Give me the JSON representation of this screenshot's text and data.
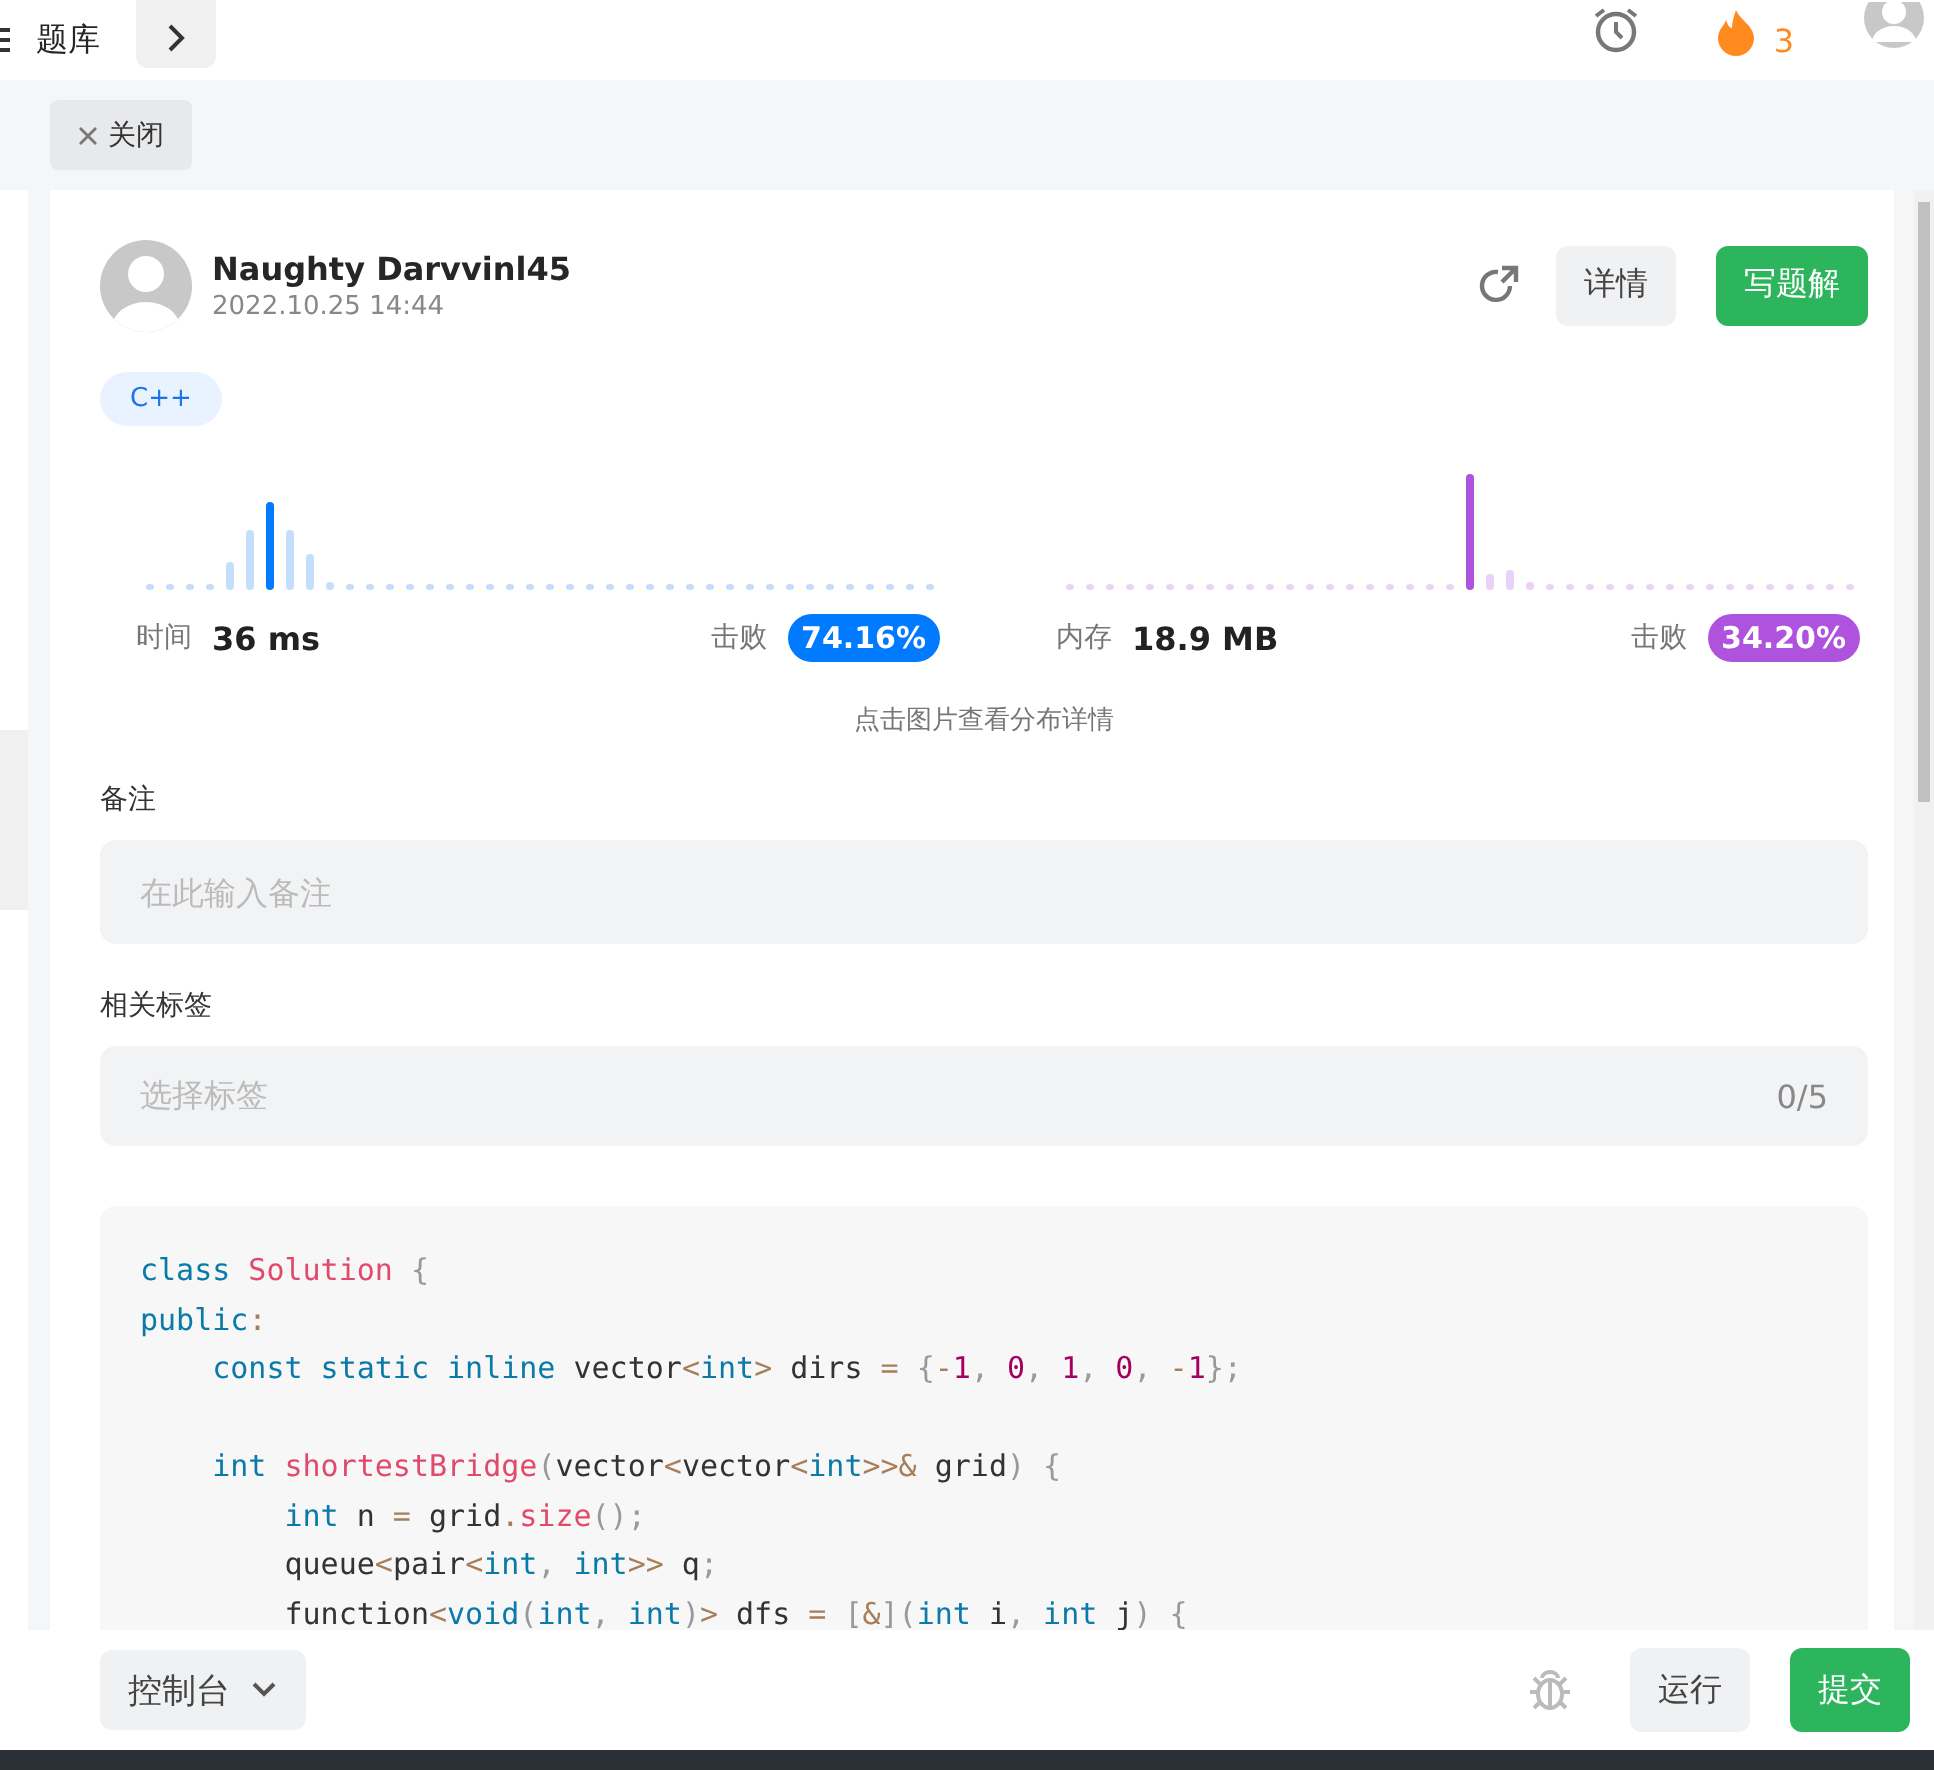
{
  "header": {
    "title": "题库",
    "streak": "3"
  },
  "close_button": "关闭",
  "solution": {
    "author": "Naughty Darvvinl45",
    "date": "2022.10.25 14:44",
    "detail_button": "详情",
    "write_button": "写题解",
    "language": "C++"
  },
  "stats": [
    {
      "label": "时间",
      "value": "36 ms",
      "beat_label": "击败",
      "beat": "74.16%",
      "color": "#007aff"
    },
    {
      "label": "内存",
      "value": "18.9 MB",
      "beat_label": "击败",
      "beat": "34.20%",
      "color": "#af52de"
    }
  ],
  "chart_hint": "点击图片查看分布详情",
  "note": {
    "label": "备注",
    "placeholder": "在此输入备注"
  },
  "tags": {
    "label": "相关标签",
    "placeholder": "选择标签",
    "count": "0/5"
  },
  "code": [
    {
      "kind": "code",
      "tokens": [
        {
          "kind": "keyword",
          "text": "class"
        },
        {
          "kind": "name",
          "text": " Solution"
        },
        {
          "kind": "punct",
          "text": " {"
        }
      ]
    },
    {
      "kind": "code",
      "tokens": [
        {
          "kind": "keyword",
          "text": "public"
        },
        {
          "kind": "op",
          "text": ":"
        }
      ]
    },
    {
      "kind": "code",
      "tokens": [
        {
          "kind": "keyword",
          "text": "    const static inline"
        },
        {
          "kind": "plain",
          "text": " vector"
        },
        {
          "kind": "op",
          "text": "<"
        },
        {
          "kind": "keyword",
          "text": "int"
        },
        {
          "kind": "op",
          "text": ">"
        },
        {
          "kind": "plain",
          "text": " dirs"
        },
        {
          "kind": "op",
          "text": " ="
        },
        {
          "kind": "punct",
          "text": " {"
        },
        {
          "kind": "op",
          "text": "-"
        },
        {
          "kind": "number",
          "text": "1"
        },
        {
          "kind": "punct",
          "text": ","
        },
        {
          "kind": "number",
          "text": " 0"
        },
        {
          "kind": "punct",
          "text": ","
        },
        {
          "kind": "number",
          "text": " 1"
        },
        {
          "kind": "punct",
          "text": ","
        },
        {
          "kind": "number",
          "text": " 0"
        },
        {
          "kind": "punct",
          "text": ","
        },
        {
          "kind": "op",
          "text": " -"
        },
        {
          "kind": "number",
          "text": "1"
        },
        {
          "kind": "punct",
          "text": "};"
        }
      ]
    },
    {
      "kind": "blank"
    },
    {
      "kind": "code",
      "tokens": [
        {
          "kind": "keyword",
          "text": "    int"
        },
        {
          "kind": "name",
          "text": " shortestBridge"
        },
        {
          "kind": "punct",
          "text": "("
        },
        {
          "kind": "plain",
          "text": "vector"
        },
        {
          "kind": "op",
          "text": "<"
        },
        {
          "kind": "plain",
          "text": "vector"
        },
        {
          "kind": "op",
          "text": "<"
        },
        {
          "kind": "keyword",
          "text": "int"
        },
        {
          "kind": "op",
          "text": ">>&"
        },
        {
          "kind": "plain",
          "text": " grid"
        },
        {
          "kind": "punct",
          "text": ") {"
        }
      ]
    },
    {
      "kind": "code",
      "tokens": [
        {
          "kind": "keyword",
          "text": "        int"
        },
        {
          "kind": "plain",
          "text": " n"
        },
        {
          "kind": "op",
          "text": " ="
        },
        {
          "kind": "plain",
          "text": " grid"
        },
        {
          "kind": "op",
          "text": "."
        },
        {
          "kind": "name",
          "text": "size"
        },
        {
          "kind": "punct",
          "text": "();"
        }
      ]
    },
    {
      "kind": "code",
      "tokens": [
        {
          "kind": "plain",
          "text": "        queue"
        },
        {
          "kind": "op",
          "text": "<"
        },
        {
          "kind": "plain",
          "text": "pair"
        },
        {
          "kind": "op",
          "text": "<"
        },
        {
          "kind": "keyword",
          "text": "int"
        },
        {
          "kind": "punct",
          "text": ","
        },
        {
          "kind": "keyword",
          "text": " int"
        },
        {
          "kind": "op",
          "text": ">>"
        },
        {
          "kind": "plain",
          "text": " q"
        },
        {
          "kind": "punct",
          "text": ";"
        }
      ]
    },
    {
      "kind": "code",
      "tokens": [
        {
          "kind": "plain",
          "text": "        function"
        },
        {
          "kind": "op",
          "text": "<"
        },
        {
          "kind": "keyword",
          "text": "void"
        },
        {
          "kind": "punct",
          "text": "("
        },
        {
          "kind": "keyword",
          "text": "int"
        },
        {
          "kind": "punct",
          "text": ","
        },
        {
          "kind": "keyword",
          "text": " int"
        },
        {
          "kind": "punct",
          "text": ")"
        },
        {
          "kind": "op",
          "text": ">"
        },
        {
          "kind": "plain",
          "text": " dfs"
        },
        {
          "kind": "op",
          "text": " ="
        },
        {
          "kind": "punct",
          "text": " ["
        },
        {
          "kind": "op",
          "text": "&"
        },
        {
          "kind": "punct",
          "text": "]("
        },
        {
          "kind": "keyword",
          "text": "int"
        },
        {
          "kind": "plain",
          "text": " i"
        },
        {
          "kind": "punct",
          "text": ","
        },
        {
          "kind": "keyword",
          "text": " int"
        },
        {
          "kind": "plain",
          "text": " j"
        },
        {
          "kind": "punct",
          "text": ") {"
        }
      ]
    }
  ],
  "bottom": {
    "console": "控制台",
    "run": "运行",
    "submit": "提交"
  }
}
